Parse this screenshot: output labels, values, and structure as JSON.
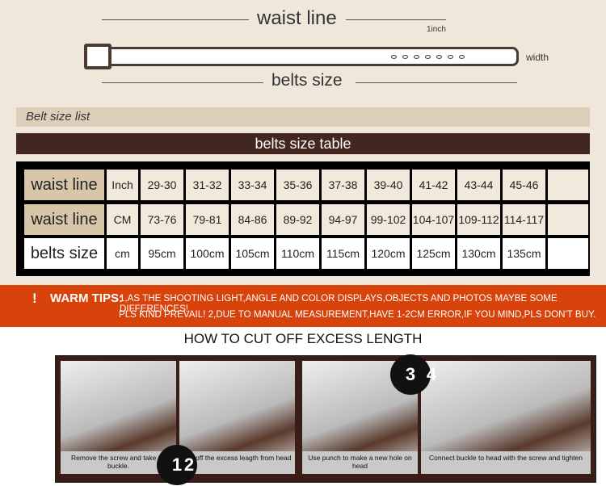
{
  "diagram": {
    "waist_line": "waist line",
    "one_inch": "1inch",
    "width": "width",
    "belts_size": "belts size"
  },
  "size_list_label": "Belt size list",
  "table_title": "belts size table",
  "table": {
    "rows": [
      {
        "label": "waist line",
        "unit": "Inch",
        "values": [
          "29-30",
          "31-32",
          "33-34",
          "35-36",
          "37-38",
          "39-40",
          "41-42",
          "43-44",
          "45-46",
          ""
        ]
      },
      {
        "label": "waist line",
        "unit": "CM",
        "values": [
          "73-76",
          "79-81",
          "84-86",
          "89-92",
          "94-97",
          "99-102",
          "104-107",
          "109-112",
          "114-117",
          ""
        ]
      },
      {
        "label": "belts size",
        "unit": "cm",
        "values": [
          "95cm",
          "100cm",
          "105cm",
          "110cm",
          "115cm",
          "120cm",
          "125cm",
          "130cm",
          "135cm",
          ""
        ]
      }
    ]
  },
  "tips": {
    "mark": "!",
    "title": "WARM TIPS:",
    "line1": "1,AS THE SHOOTING LIGHT,ANGLE AND COLOR DISPLAYS,OBJECTS AND PHOTOS MAYBE SOME DIFFERENCES!",
    "line2": "PLS KIND PREVAIL! 2,DUE TO MANUAL MEASUREMENT,HAVE 1-2CM ERROR,IF YOU MIND,PLS DON'T BUY."
  },
  "howto_title": "HOW TO CUT OFF EXCESS LENGTH",
  "steps": [
    {
      "num": "1",
      "caption": "Remove the screw and take off buckle."
    },
    {
      "num": "2",
      "caption": "Cut off the excess leagth from head"
    },
    {
      "num": "3",
      "caption": "Use punch to make a new hole on head"
    },
    {
      "num": "4",
      "caption": "Connect buckle to head with the screw and tighten"
    }
  ],
  "colors": {
    "dark_brown": "#43261f",
    "tips_orange": "#d8430c",
    "beige": "#efe7da"
  }
}
